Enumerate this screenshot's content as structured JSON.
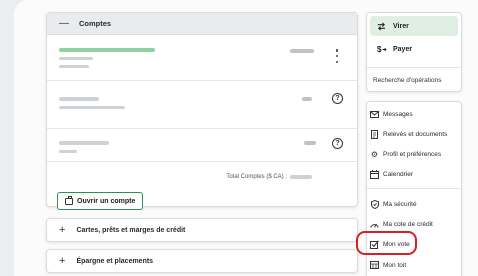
{
  "accounts": {
    "title": "Comptes",
    "collapse_symbol": "—",
    "total_label": "Total Comptes ($ CA) :",
    "open_account_label": "Ouvrir un compte"
  },
  "credit_section": {
    "symbol": "+",
    "label": "Cartes, prêts et marges de crédit"
  },
  "savings_section": {
    "symbol": "+",
    "label": "Épargne et placements"
  },
  "actions": {
    "transfer_label": "Virer",
    "pay_label": "Payer",
    "search_operations_label": "Recherche d'opérations"
  },
  "menu": {
    "items": [
      {
        "label": "Messages",
        "icon": "envelope-icon"
      },
      {
        "label": "Relevés et documents",
        "icon": "document-icon"
      },
      {
        "label": "Profil et préférences",
        "icon": "gear-icon"
      },
      {
        "label": "Calendrier",
        "icon": "calendar-icon"
      },
      {
        "label": "Ma sécurité",
        "icon": "shield-icon"
      },
      {
        "label": "Ma cote de crédit",
        "icon": "gauge-icon"
      },
      {
        "label": "Mon vote",
        "icon": "checkbox-icon"
      },
      {
        "label": "Mon toit",
        "icon": "house-icon"
      }
    ]
  },
  "colors": {
    "accent_green": "#2e8f55",
    "highlight_red": "#d42027",
    "transfer_bg": "#dff0e3"
  }
}
